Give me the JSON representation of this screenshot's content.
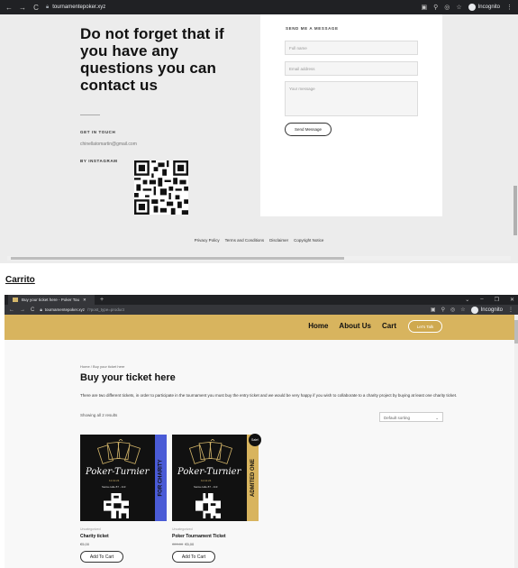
{
  "contact_screenshot": {
    "browser": {
      "url": "tournamentepoker.xyz",
      "profile": "Incognito"
    },
    "heading": "Do not forget that if you have any questions you can contact us",
    "get_in_touch_label": "GET IN TOUCH",
    "email": "chinellatomartin@gmail.com",
    "instagram_label": "BY INSTAGRAM",
    "form": {
      "title": "SEND ME A MESSAGE",
      "full_name_placeholder": "Full name",
      "email_placeholder": "Email address",
      "message_placeholder": "Your message",
      "submit_label": "Send Message"
    },
    "footer_links": [
      "Privacy Policy",
      "Terms and Conditions",
      "Disclaimer",
      "Copyright Notice"
    ]
  },
  "caption": "Carrito",
  "shop_screenshot": {
    "browser": {
      "tab_title": "Buy your ticket here - Poker Tou",
      "url_host": "tournamentepoker.xyz",
      "url_path": "/?post_type=product",
      "profile": "Incognito"
    },
    "nav": [
      "Home",
      "About Us",
      "Cart"
    ],
    "cta_label": "Let's Talk",
    "breadcrumb": "Home / Buy your ticket here",
    "title": "Buy your ticket here",
    "description": "There are two different tickets, in order to participate in the tournament you must buy the entry ticket and we would be very happy if you wish to collaborate to a charity project by buying at least one charity ticket.",
    "result_count": "Showing all 2 results",
    "sorting": "Default sorting",
    "products": [
      {
        "category": "Uncategorized",
        "name": "Charity ticket",
        "price": "€5,00",
        "old_price": "",
        "band_text": "FOR CHARITY",
        "band_color": "#4a5bd6",
        "image_title": "Poker-Turnier",
        "image_date": "11.12.21",
        "image_place": "Santa calle 87 - 113",
        "sale_badge": "",
        "button": "Add To Cart"
      },
      {
        "category": "Uncategorized",
        "name": "Poker Tournament Ticket",
        "price": "€5,00",
        "old_price": "€20,00",
        "band_text": "ADMITED ONE",
        "band_color": "#d8b45e",
        "image_title": "Poker-Turnier",
        "image_date": "11.12.21",
        "image_place": "Santa calle 87 - 113",
        "sale_badge": "Sale!",
        "button": "Add To Cart"
      }
    ]
  }
}
